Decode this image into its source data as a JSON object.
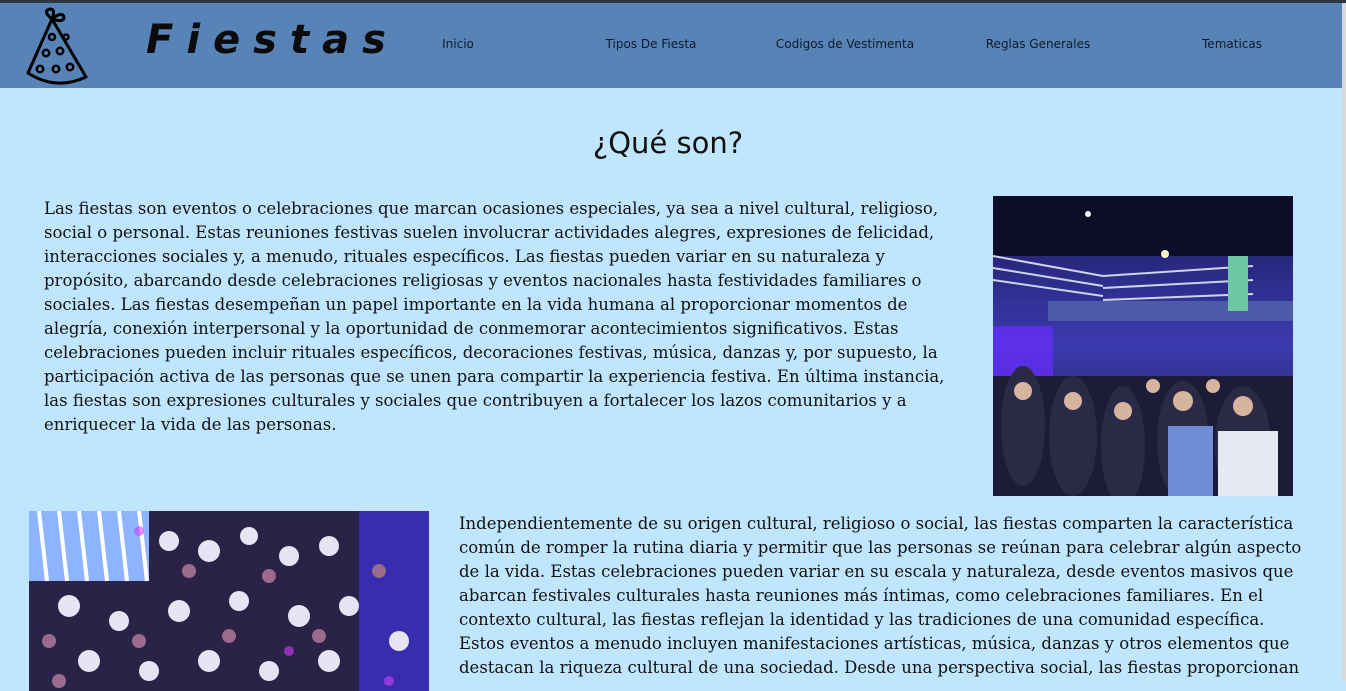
{
  "header": {
    "brand": "Fiestas",
    "logo_icon": "party-hat-icon",
    "nav": [
      {
        "label": "Inicio"
      },
      {
        "label": "Tipos De Fiesta"
      },
      {
        "label": "Codigos de Vestimenta"
      },
      {
        "label": "Reglas Generales"
      },
      {
        "label": "Tematicas"
      }
    ]
  },
  "main": {
    "title": "¿Qué son?",
    "paragraph1": "Las fiestas son eventos o celebraciones que marcan ocasiones especiales, ya sea a nivel cultural, religioso,\nsocial o personal. Estas reuniones festivas suelen involucrar actividades alegres, expresiones de felicidad,\ninteracciones sociales y, a menudo, rituales específicos. Las fiestas pueden variar en su naturaleza y\npropósito, abarcando desde celebraciones religiosas y eventos nacionales hasta festividades familiares o\nsociales. Las fiestas desempeñan un papel importante en la vida humana al proporcionar momentos de\nalegría, conexión interpersonal y la oportunidad de conmemorar acontecimientos significativos. Estas\ncelebraciones pueden incluir rituales específicos, decoraciones festivas, música, danzas y, por supuesto, la\nparticipación activa de las personas que se unen para compartir la experiencia festiva. En última instancia,\nlas fiestas son expresiones culturales y sociales que contribuyen a fortalecer los lazos comunitarios y a\nenriquecer la vida de las personas.",
    "paragraph2": "Independientemente de su origen cultural, religioso o social, las fiestas comparten la característica\ncomún de romper la rutina diaria y permitir que las personas se reúnan para celebrar algún aspecto\nde la vida. Estas celebraciones pueden variar en su escala y naturaleza, desde eventos masivos que\nabarcan festivales culturales hasta reuniones más íntimas, como celebraciones familiares. En el\ncontexto cultural, las fiestas reflejan la identidad y las tradiciones de una comunidad específica.\nEstos eventos a menudo incluyen manifestaciones artísticas, música, danzas y otros elementos que\ndestacan la riqueza cultural de una sociedad. Desde una perspectiva social, las fiestas proporcionan"
  },
  "colors": {
    "page_bg": "#bfe6fe",
    "navbar_bg": "#5783b6",
    "text": "#111111"
  }
}
